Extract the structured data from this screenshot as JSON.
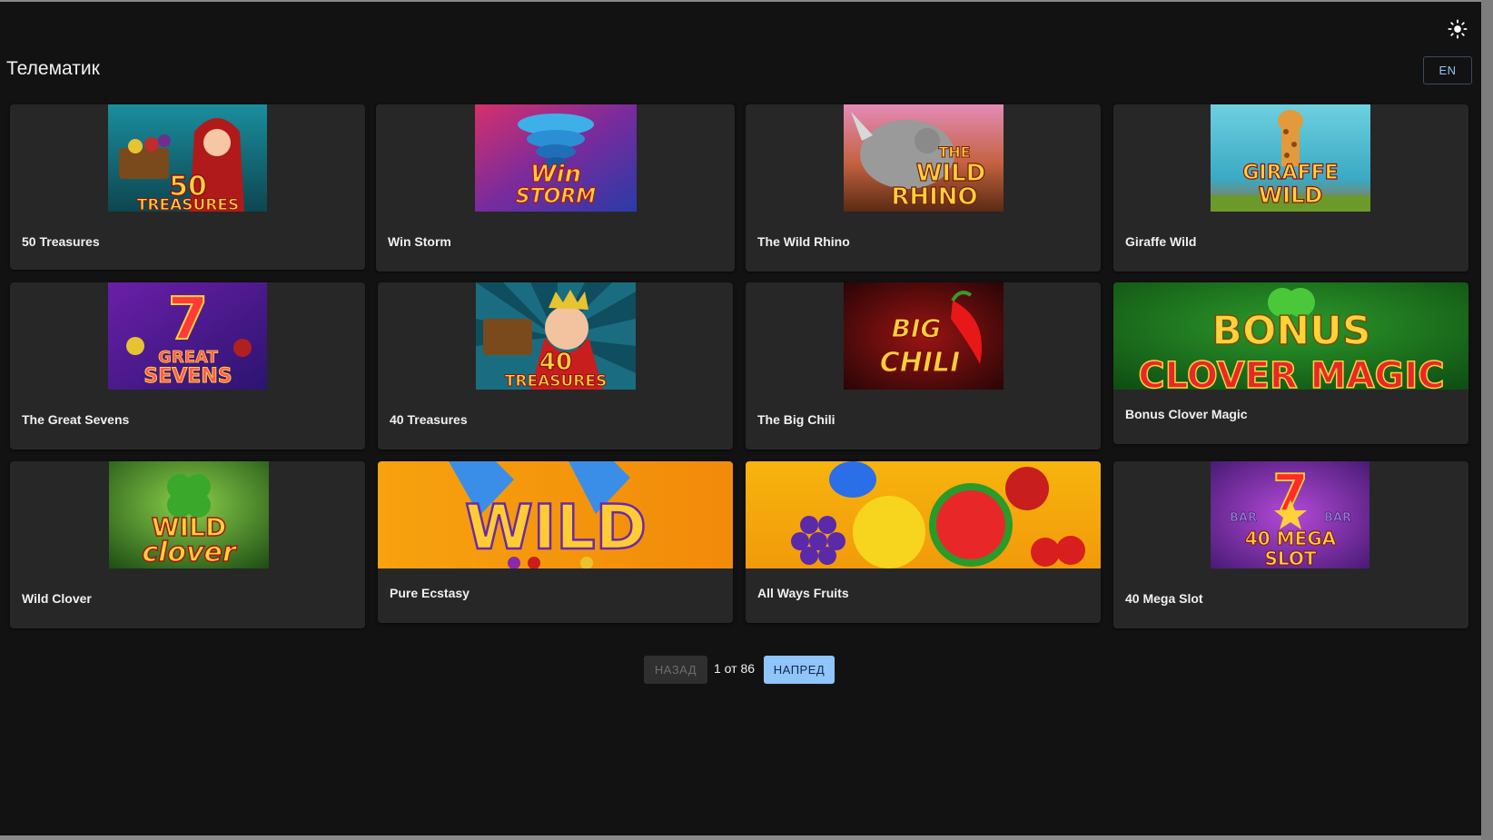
{
  "header": {
    "title": "Телематик",
    "language_button": "EN",
    "theme_icon": "sun-icon"
  },
  "games": [
    {
      "title": "50 Treasures",
      "art_text": [
        "50",
        "TREASURES"
      ]
    },
    {
      "title": "Win Storm",
      "art_text": [
        "Win",
        "STORM"
      ]
    },
    {
      "title": "The Wild Rhino",
      "art_text": [
        "THE",
        "WILD",
        "RHINO"
      ]
    },
    {
      "title": "Giraffe Wild",
      "art_text": [
        "GIRAFFE",
        "WILD"
      ]
    },
    {
      "title": "The Great Sevens",
      "art_text": [
        "7",
        "GREAT",
        "SEVENS"
      ]
    },
    {
      "title": "40 Treasures",
      "art_text": [
        "40",
        "TREASURES"
      ]
    },
    {
      "title": "The Big Chili",
      "art_text": [
        "BIG",
        "CHILI"
      ]
    },
    {
      "title": "Bonus Clover Magic",
      "art_text": [
        "BONUS",
        "CLOVER MAGIC"
      ]
    },
    {
      "title": "Wild Clover",
      "art_text": [
        "WILD",
        "clover"
      ]
    },
    {
      "title": "Pure Ecstasy",
      "art_text": [
        "WILD"
      ]
    },
    {
      "title": "All Ways Fruits",
      "art_text": []
    },
    {
      "title": "40 Mega Slot",
      "art_text": [
        "7",
        "BAR",
        "BAR",
        "40 MEGA",
        "SLOT"
      ]
    }
  ],
  "pagination": {
    "prev_label": "НАЗАД",
    "info": "1 от 86",
    "next_label": "НАПРЕД"
  },
  "colors": {
    "background": "#121212",
    "card": "#272727",
    "accent": "#8fc5fb"
  }
}
